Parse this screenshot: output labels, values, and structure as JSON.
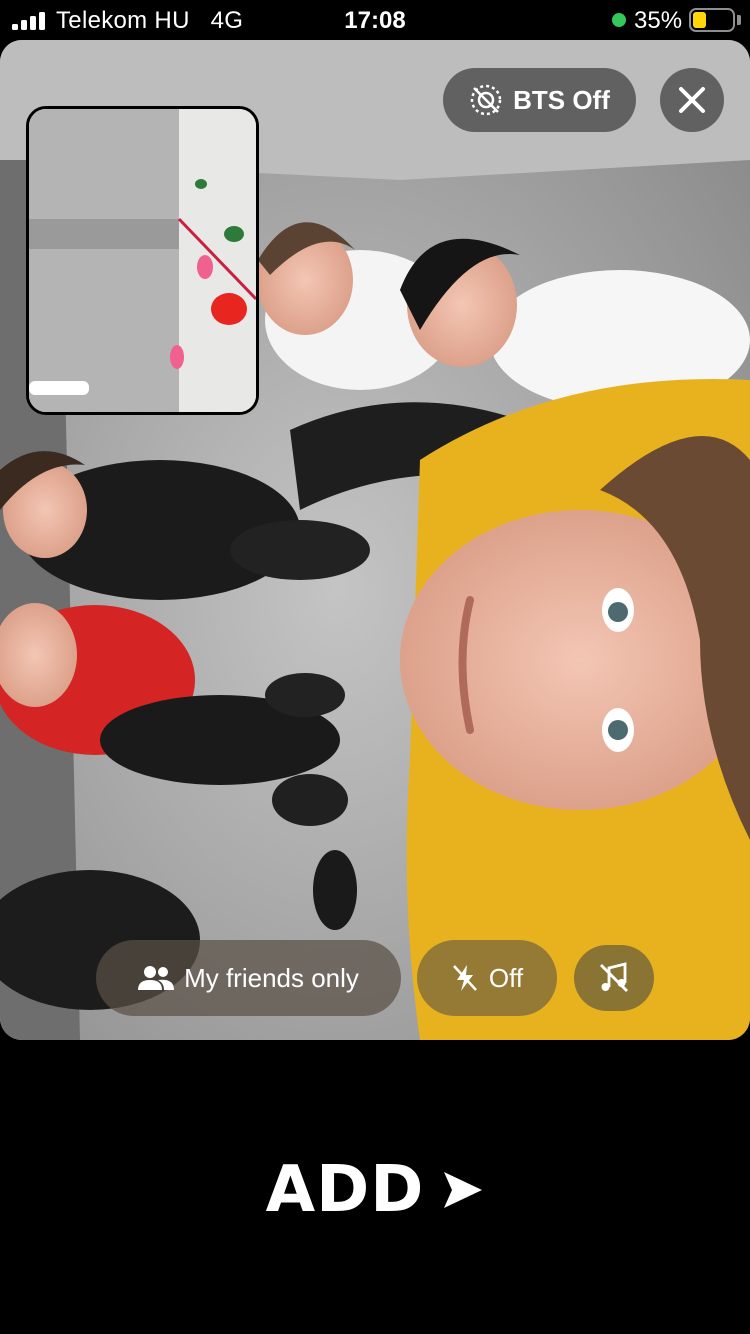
{
  "status_bar": {
    "carrier": "Telekom HU",
    "network": "4G",
    "time": "17:08",
    "battery_percent_label": "35%",
    "battery_level": 0.35,
    "signal_bars": 4,
    "battery_color": "#ffd60a",
    "location_dot_color": "#34c759"
  },
  "top_controls": {
    "bts_label": "BTS Off",
    "bts_icon": "camera-off-icon",
    "close_icon": "close-icon"
  },
  "bottom_controls": {
    "audience_label": "My friends only",
    "audience_icon": "people-icon",
    "flash_label": "Off",
    "flash_icon": "flash-off-icon",
    "music_icon": "music-off-icon"
  },
  "post": {
    "add_label": "ADD",
    "add_icon": "send-arrow-icon"
  }
}
